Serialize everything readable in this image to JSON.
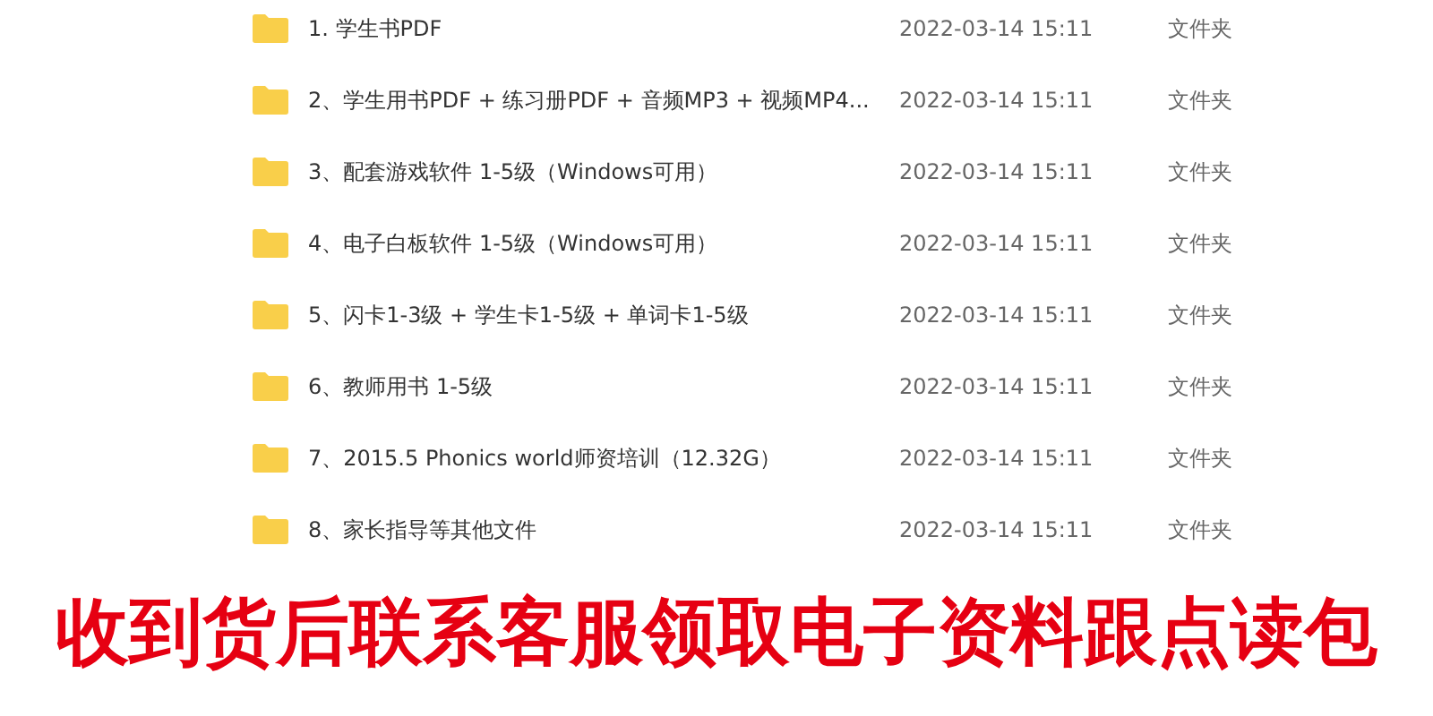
{
  "files": [
    {
      "name": "1. 学生书PDF",
      "modified": "2022-03-14 15:11",
      "type": "文件夹"
    },
    {
      "name": "2、学生用书PDF + 练习册PDF + 音频MP3 + 视频MP4...",
      "modified": "2022-03-14 15:11",
      "type": "文件夹"
    },
    {
      "name": "3、配套游戏软件 1-5级（Windows可用）",
      "modified": "2022-03-14 15:11",
      "type": "文件夹"
    },
    {
      "name": "4、电子白板软件 1-5级（Windows可用）",
      "modified": "2022-03-14 15:11",
      "type": "文件夹"
    },
    {
      "name": "5、闪卡1-3级 + 学生卡1-5级 + 单词卡1-5级",
      "modified": "2022-03-14 15:11",
      "type": "文件夹"
    },
    {
      "name": "6、教师用书 1-5级",
      "modified": "2022-03-14 15:11",
      "type": "文件夹"
    },
    {
      "name": "7、2015.5 Phonics world师资培训（12.32G）",
      "modified": "2022-03-14 15:11",
      "type": "文件夹"
    },
    {
      "name": "8、家长指导等其他文件",
      "modified": "2022-03-14 15:11",
      "type": "文件夹"
    }
  ],
  "banner": "收到货后联系客服领取电子资料跟点读包"
}
